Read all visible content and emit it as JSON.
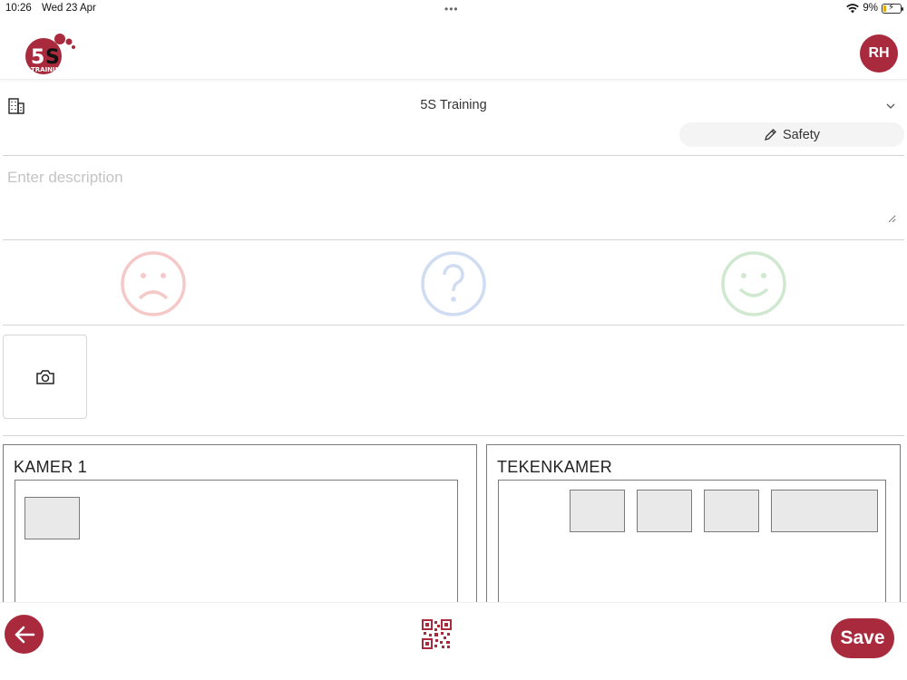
{
  "status_bar": {
    "time": "10:26",
    "date": "Wed 23 Apr",
    "battery": "9%",
    "battery_level": 0.09,
    "icons": [
      "wifi-icon",
      "battery-icon",
      "multitask-dots-icon"
    ]
  },
  "header": {
    "logo_text": "TRAINING",
    "logo_mark": "5S",
    "avatar_initials": "RH"
  },
  "location": {
    "name": "5S Training",
    "icon": "building-icon"
  },
  "category": {
    "label": "Safety",
    "icon": "pencil-icon"
  },
  "description": {
    "value": "",
    "placeholder": "Enter description"
  },
  "ratings": [
    {
      "name": "sad",
      "icon": "sad-face-icon",
      "color": "#f6c9c9"
    },
    {
      "name": "unknown",
      "icon": "question-icon",
      "color": "#cfdcf2"
    },
    {
      "name": "happy",
      "icon": "happy-face-icon",
      "color": "#cfe8cf"
    }
  ],
  "photo": {
    "icon": "camera-icon"
  },
  "rooms": [
    {
      "title": "KAMER 1",
      "zones": 1
    },
    {
      "title": "TEKENKAMER",
      "zones": 4
    }
  ],
  "footer": {
    "back_icon": "arrow-left-icon",
    "qr_icon": "qr-code-icon",
    "save_label": "Save"
  },
  "colors": {
    "brand": "#a82a3c",
    "sad": "#f6c9c9",
    "unknown": "#cfdcf2",
    "happy": "#cfe8cf"
  }
}
